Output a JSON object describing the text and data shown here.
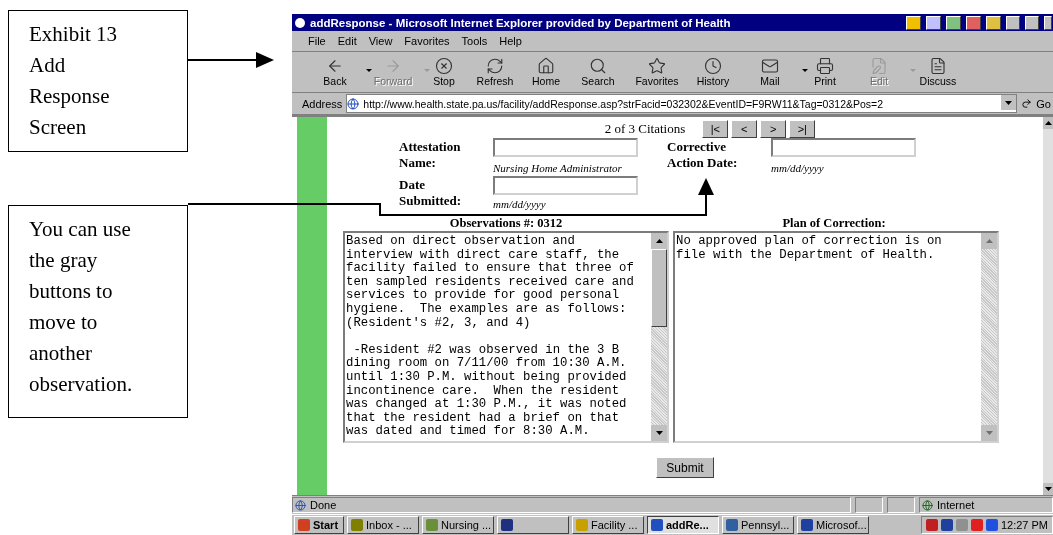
{
  "callouts": [
    {
      "text": "Exhibit 13\nAdd\nResponse\nScreen"
    },
    {
      "text": "You can use\nthe gray\nbuttons to\nmove to\nanother\nobservation."
    }
  ],
  "window": {
    "title": "addResponse - Microsoft Internet Explorer provided by Department of Health"
  },
  "menu": [
    "File",
    "Edit",
    "View",
    "Favorites",
    "Tools",
    "Help"
  ],
  "toolbar": [
    {
      "label": "Back",
      "disabled": false,
      "dropdown": true
    },
    {
      "label": "Forward",
      "disabled": true,
      "dropdown": true
    },
    {
      "label": "Stop",
      "disabled": false,
      "dropdown": false
    },
    {
      "label": "Refresh",
      "disabled": false,
      "dropdown": false
    },
    {
      "label": "Home",
      "disabled": false,
      "dropdown": false
    },
    {
      "label": "Search",
      "disabled": false,
      "dropdown": false
    },
    {
      "label": "Favorites",
      "disabled": false,
      "dropdown": false
    },
    {
      "label": "History",
      "disabled": false,
      "dropdown": false
    },
    {
      "label": "Mail",
      "disabled": false,
      "dropdown": true
    },
    {
      "label": "Print",
      "disabled": false,
      "dropdown": false
    },
    {
      "label": "Edit",
      "disabled": true,
      "dropdown": true
    },
    {
      "label": "Discuss",
      "disabled": false,
      "dropdown": false
    }
  ],
  "address": {
    "label": "Address",
    "url": "http://www.health.state.pa.us/facility/addResponse.asp?strFacid=032302&EventID=F9RW11&Tag=0312&Pos=2",
    "go": "Go"
  },
  "page": {
    "citations": "2 of 3 Citations",
    "nav_buttons": [
      "|<",
      "<",
      ">",
      ">|"
    ],
    "fields": [
      {
        "label": "Attestation Name:",
        "hint": "Nursing Home Administrator"
      },
      {
        "label": "Corrective Action Date:",
        "hint": "mm/dd/yyyy"
      },
      {
        "label": "Date Submitted:",
        "hint": "mm/dd/yyyy"
      }
    ],
    "observations": {
      "heading": "Observations #: 0312",
      "text": "Based on direct observation and interview with direct care staff, the facility failed to ensure that three of ten sampled residents received care and services to provide for good personal hygiene.  The examples are as follows: (Resident's #2, 3, and 4)\n\n -Resident #2 was observed in the 3 B dining room on 7/11/00 from 10:30 A.M. until 1:30 P.M. without being provided incontinence care.  When the resident was changed at 1:30 P.M., it was noted that the resident had a brief on that was dated and timed for 8:30 A.M."
    },
    "plan": {
      "heading": "Plan of Correction:",
      "text": "No approved plan of correction is on file with the Department of Health."
    },
    "submit": "Submit"
  },
  "status_bar": {
    "text": "Done",
    "zone": "Internet"
  },
  "taskbar": {
    "start": "Start",
    "items": [
      {
        "label": "Inbox - ...",
        "selected": false
      },
      {
        "label": "Nursing ...",
        "selected": false
      },
      {
        "selected": false
      },
      {
        "label": "Facility ...",
        "selected": false
      },
      {
        "label": "addRe...",
        "selected": true
      },
      {
        "label": "Pennsyl...",
        "selected": false
      },
      {
        "label": "Microsof...",
        "selected": false
      }
    ],
    "clock": "12:27 PM"
  }
}
